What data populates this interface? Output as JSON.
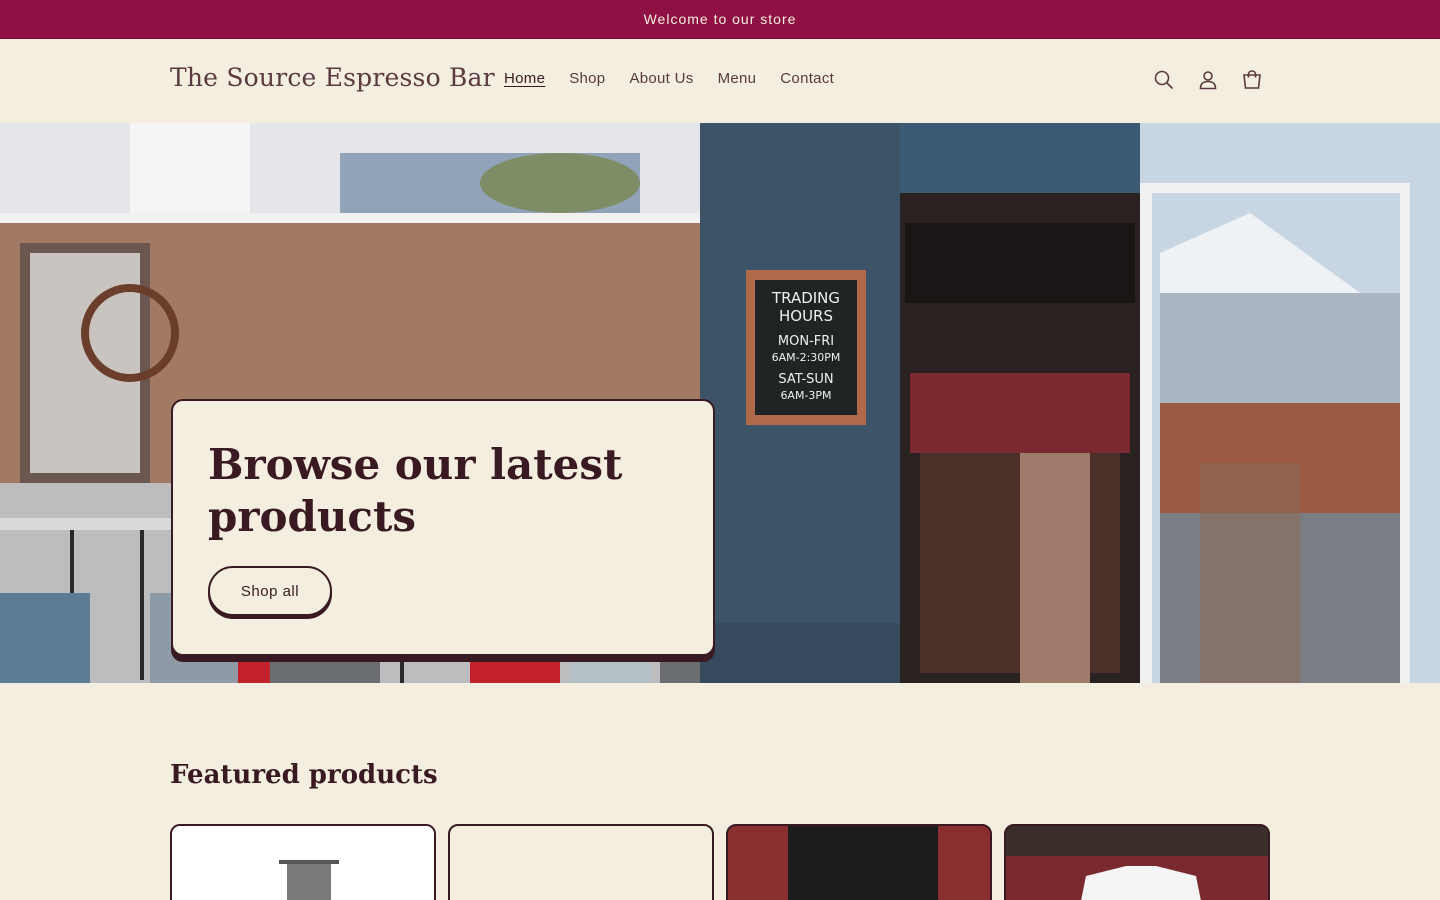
{
  "announcement": {
    "text": "Welcome to our store"
  },
  "header": {
    "logo": "The Source Espresso Bar",
    "nav": [
      {
        "label": "Home",
        "active": true
      },
      {
        "label": "Shop",
        "active": false
      },
      {
        "label": "About Us",
        "active": false
      },
      {
        "label": "Menu",
        "active": false
      },
      {
        "label": "Contact",
        "active": false
      }
    ],
    "icons": [
      "search-icon",
      "account-icon",
      "cart-icon"
    ]
  },
  "hero": {
    "title": "Browse our latest products",
    "button_label": "Shop all",
    "chalkboard": {
      "line1": "TRADING",
      "line2": "HOURS",
      "line3": "MON-FRI",
      "line4": "6AM-2:30PM",
      "line5": "SAT-SUN",
      "line6": "6AM-3PM"
    }
  },
  "featured": {
    "title": "Featured products"
  },
  "colors": {
    "accent": "#8f1042",
    "background": "#f3eedf",
    "text": "#3a1a22"
  }
}
